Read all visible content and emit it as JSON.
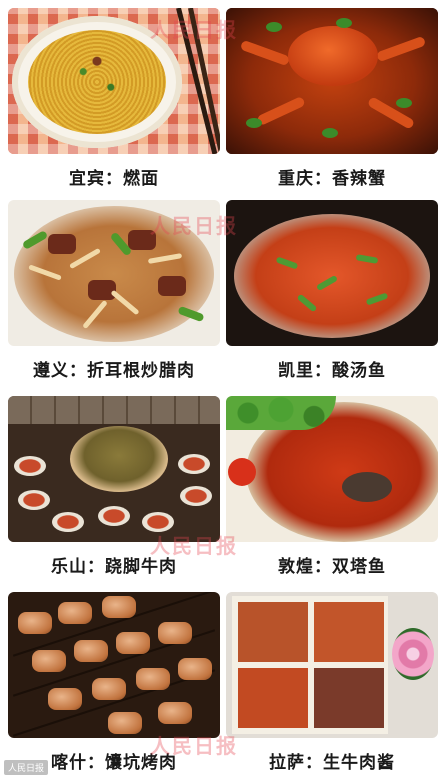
{
  "dishes": [
    {
      "caption": "宜宾：燃面"
    },
    {
      "caption": "重庆：香辣蟹"
    },
    {
      "caption": "遵义：折耳根炒腊肉"
    },
    {
      "caption": "凯里：酸汤鱼"
    },
    {
      "caption": "乐山：跷脚牛肉"
    },
    {
      "caption": "敦煌：双塔鱼"
    },
    {
      "caption": "喀什：馕坑烤肉"
    },
    {
      "caption": "拉萨：生牛肉酱"
    }
  ],
  "watermarks": [
    "人民日报",
    "人民日报",
    "人民日报",
    "人民日报"
  ],
  "footer": {
    "source": "人民日报"
  }
}
